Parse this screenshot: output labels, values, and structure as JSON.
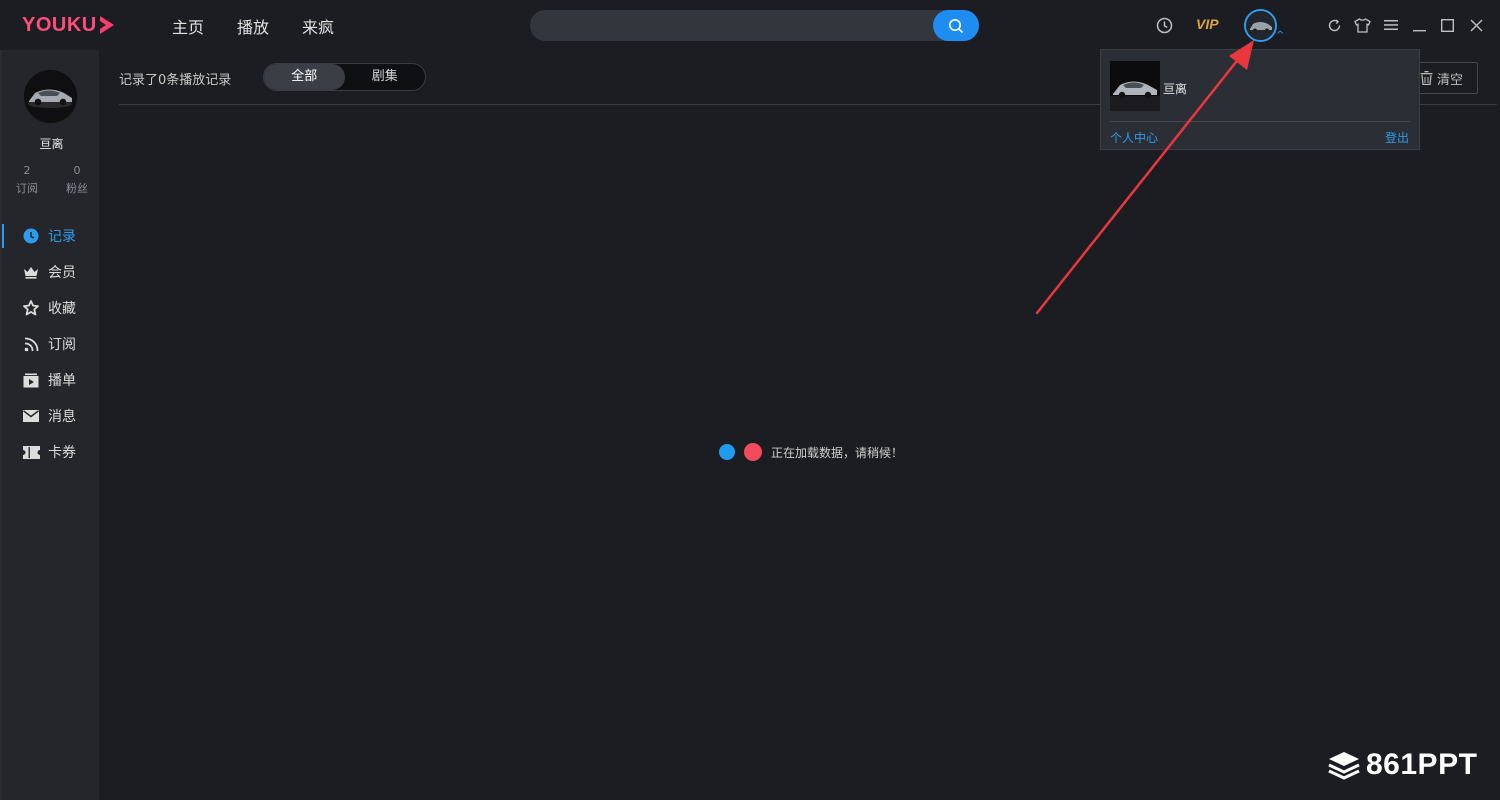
{
  "app": {
    "logo_text": "YOUKU"
  },
  "nav": {
    "items": [
      "主页",
      "播放",
      "来疯"
    ]
  },
  "search": {
    "placeholder": ""
  },
  "topbar": {
    "vip_label": "VIP"
  },
  "user": {
    "name": "亘离",
    "subscriptions": "2",
    "subscriptions_label": "订阅",
    "fans": "0",
    "fans_label": "粉丝"
  },
  "sidebar": {
    "items": [
      {
        "label": "记录",
        "icon": "clock-icon",
        "active": true
      },
      {
        "label": "会员",
        "icon": "crown-icon"
      },
      {
        "label": "收藏",
        "icon": "star-icon"
      },
      {
        "label": "订阅",
        "icon": "rss-icon"
      },
      {
        "label": "播单",
        "icon": "playlist-icon"
      },
      {
        "label": "消息",
        "icon": "mail-icon"
      },
      {
        "label": "卡券",
        "icon": "ticket-icon"
      }
    ]
  },
  "main": {
    "record_count": "记录了0条播放记录",
    "tabs": [
      "全部",
      "剧集"
    ],
    "clear_label": "清空",
    "loading_text": "正在加载数据，请稍候！"
  },
  "dropdown": {
    "name": "亘离",
    "profile_link": "个人中心",
    "logout_link": "登出"
  },
  "colors": {
    "accent": "#2d9cf0",
    "brand": "#ff4e7b",
    "vip": "#d9a441",
    "annotation": "#e8383d",
    "dot_blue": "#1e9cf0",
    "dot_red": "#f24b5e"
  },
  "watermark": {
    "text": "861PPT"
  }
}
